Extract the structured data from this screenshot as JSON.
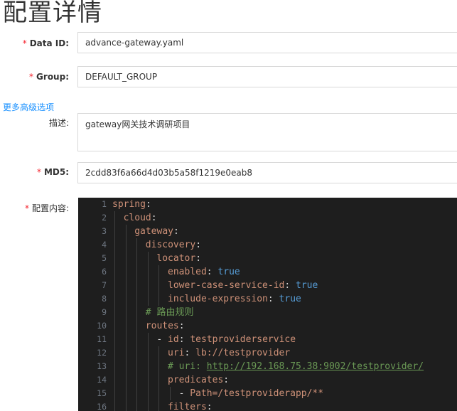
{
  "page": {
    "title": "配置详情"
  },
  "form": {
    "data_id": {
      "label": "Data ID:",
      "required_mark": "*",
      "value": "advance-gateway.yaml"
    },
    "group": {
      "label": "Group:",
      "required_mark": "*",
      "value": "DEFAULT_GROUP"
    },
    "advanced_link": "更多高级选项",
    "description": {
      "label": "描述:",
      "value": "gateway网关技术调研项目"
    },
    "md5": {
      "label": "MD5:",
      "required_mark": "*",
      "value": "2cdd83f6a66d4d03b5a58f1219e0eab8"
    },
    "content": {
      "label": "配置内容:",
      "required_mark": "*"
    }
  },
  "editor": {
    "theme_colors": {
      "background": "#1e1e1e",
      "key": "#ce9178",
      "bool": "#569cd6",
      "comment": "#6a9955",
      "line_number": "#6e7681"
    },
    "lines": [
      {
        "n": "1",
        "indent": 0,
        "tokens": [
          [
            "k",
            "spring"
          ],
          [
            "p",
            ":"
          ]
        ]
      },
      {
        "n": "2",
        "indent": 1,
        "tokens": [
          [
            "k",
            "cloud"
          ],
          [
            "p",
            ":"
          ]
        ]
      },
      {
        "n": "3",
        "indent": 2,
        "tokens": [
          [
            "k",
            "gateway"
          ],
          [
            "p",
            ":"
          ]
        ]
      },
      {
        "n": "4",
        "indent": 3,
        "tokens": [
          [
            "k",
            "discovery"
          ],
          [
            "p",
            ":"
          ]
        ]
      },
      {
        "n": "5",
        "indent": 4,
        "tokens": [
          [
            "k",
            "locator"
          ],
          [
            "p",
            ":"
          ]
        ]
      },
      {
        "n": "6",
        "indent": 5,
        "tokens": [
          [
            "k",
            "enabled"
          ],
          [
            "p",
            ": "
          ],
          [
            "b",
            "true"
          ]
        ]
      },
      {
        "n": "7",
        "indent": 5,
        "tokens": [
          [
            "k",
            "lower-case-service-id"
          ],
          [
            "p",
            ": "
          ],
          [
            "b",
            "true"
          ]
        ]
      },
      {
        "n": "8",
        "indent": 5,
        "tokens": [
          [
            "k",
            "include-expression"
          ],
          [
            "p",
            ": "
          ],
          [
            "b",
            "true"
          ]
        ]
      },
      {
        "n": "9",
        "indent": 3,
        "tokens": [
          [
            "c",
            "# 路由规则"
          ]
        ]
      },
      {
        "n": "10",
        "indent": 3,
        "tokens": [
          [
            "k",
            "routes"
          ],
          [
            "p",
            ":"
          ]
        ]
      },
      {
        "n": "11",
        "indent": 4,
        "tokens": [
          [
            "p",
            "- "
          ],
          [
            "k",
            "id"
          ],
          [
            "p",
            ": "
          ],
          [
            "k",
            "testproviderservice"
          ]
        ]
      },
      {
        "n": "12",
        "indent": 5,
        "tokens": [
          [
            "k",
            "uri"
          ],
          [
            "p",
            ": "
          ],
          [
            "k",
            "lb://testprovider"
          ]
        ]
      },
      {
        "n": "13",
        "indent": 5,
        "tokens": [
          [
            "c",
            "# uri: "
          ],
          [
            "u",
            "http://192.168.75.38:9002/testprovider/"
          ]
        ]
      },
      {
        "n": "14",
        "indent": 5,
        "tokens": [
          [
            "k",
            "predicates"
          ],
          [
            "p",
            ":"
          ]
        ]
      },
      {
        "n": "15",
        "indent": 6,
        "tokens": [
          [
            "p",
            "- "
          ],
          [
            "k",
            "Path=/testproviderapp/**"
          ]
        ]
      },
      {
        "n": "16",
        "indent": 5,
        "tokens": [
          [
            "k",
            "filters"
          ],
          [
            "p",
            ":"
          ]
        ]
      }
    ]
  }
}
